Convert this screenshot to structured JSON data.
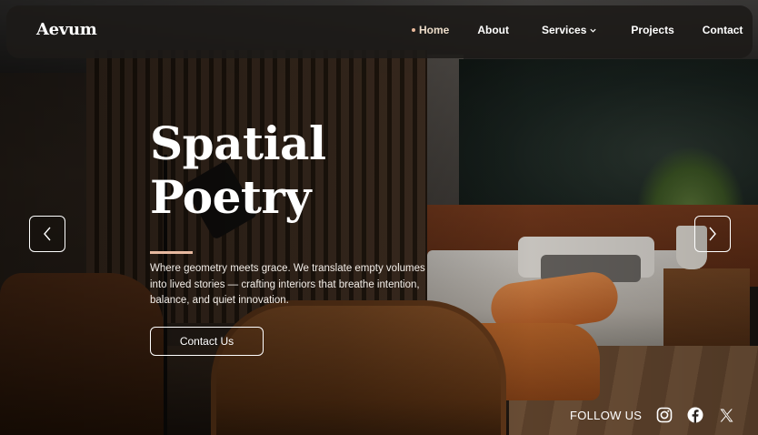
{
  "brand": {
    "logo": "Aevum"
  },
  "nav": {
    "items": [
      {
        "label": "Home",
        "active": true
      },
      {
        "label": "About"
      },
      {
        "label": "Services",
        "has_dropdown": true
      },
      {
        "label": "Projects"
      },
      {
        "label": "Contact"
      }
    ]
  },
  "hero": {
    "title_line1": "Spatial",
    "title_line2": "Poetry",
    "description": "Where geometry meets grace. We translate empty volumes into lived stories — crafting interiors that breathe intention, balance, and quiet innovation.",
    "cta_label": "Contact Us"
  },
  "carousel": {
    "prev_icon": "chevron-left-icon",
    "next_icon": "chevron-right-icon"
  },
  "social": {
    "label": "FOLLOW US",
    "icons": [
      "instagram-icon",
      "facebook-icon",
      "x-icon"
    ]
  },
  "colors": {
    "accent": "#e7b9a0",
    "nav_bg": "#1c1a18",
    "text": "#ffffff"
  }
}
